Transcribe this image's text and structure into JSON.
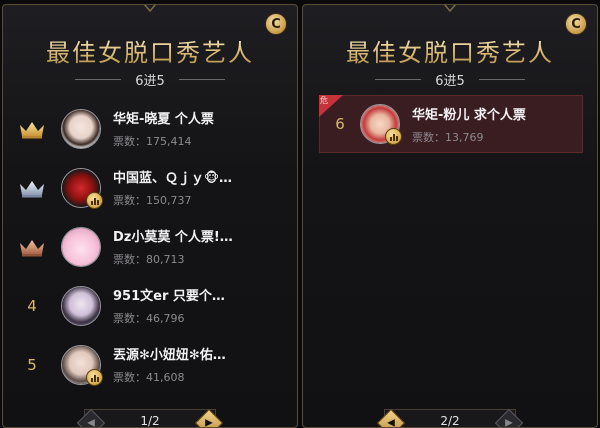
{
  "colors": {
    "gold": "#d9b86a",
    "panel_bg": "#141416",
    "highlight_bg": "#3a1d20"
  },
  "panels": [
    {
      "title": "最佳女脱口秀艺人",
      "round": "6进5",
      "badge": "C",
      "pager": "1/2",
      "entries": [
        {
          "rank": "1",
          "rank_icon": "gold-crown-icon",
          "name": "华矩-晓夏 个人票",
          "votes": "票数：175,414"
        },
        {
          "rank": "2",
          "rank_icon": "silver-crown-icon",
          "name": "中国蓝、Ｑｊｙ🐵…",
          "votes": "票数：150,737"
        },
        {
          "rank": "3",
          "rank_icon": "bronze-crown-icon",
          "name": "Dz小莫莫 个人票!…",
          "votes": "票数：80,713"
        },
        {
          "rank": "4",
          "rank_icon": null,
          "name": "951文er 只要个…",
          "votes": "票数：46,796"
        },
        {
          "rank": "5",
          "rank_icon": null,
          "name": "丟源✻小妞妞✻佑…",
          "votes": "票数：41,608"
        }
      ]
    },
    {
      "title": "最佳女脱口秀艺人",
      "round": "6进5",
      "badge": "C",
      "pager": "2/2",
      "entries": [
        {
          "rank": "6",
          "tag": "危",
          "name": "华矩-粉儿 求个人票",
          "votes": "票数：13,769"
        }
      ]
    }
  ]
}
